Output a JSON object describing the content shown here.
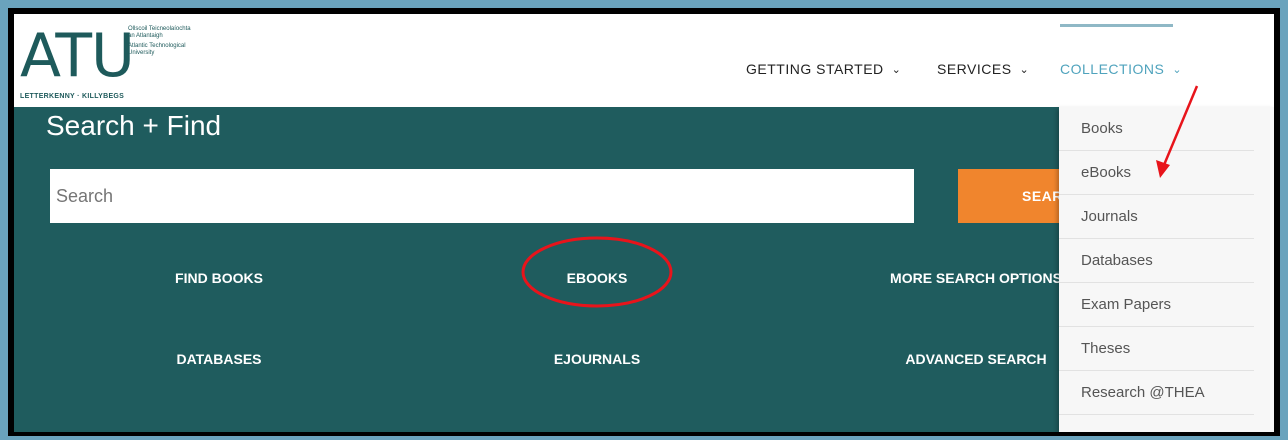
{
  "logo": {
    "letters": "ATU",
    "tagline_ga": "Ollscoil Teicneolaíochta an Atlantaigh",
    "tagline_en": "Atlantic Technological University",
    "campus": "LETTERKENNY · KILLYBEGS"
  },
  "nav": [
    {
      "label": "GETTING STARTED"
    },
    {
      "label": "SERVICES"
    },
    {
      "label": "COLLECTIONS"
    }
  ],
  "search": {
    "title": "Search + Find",
    "placeholder": "Search",
    "button_label": "SEARCH"
  },
  "quick_links": [
    {
      "label": "FIND BOOKS"
    },
    {
      "label": "EBOOKS"
    },
    {
      "label": "MORE SEARCH OPTIONS"
    },
    {
      "label": "DATABASES"
    },
    {
      "label": "EJOURNALS"
    },
    {
      "label": "ADVANCED SEARCH"
    }
  ],
  "collections_menu": [
    {
      "label": "Books"
    },
    {
      "label": "eBooks"
    },
    {
      "label": "Journals"
    },
    {
      "label": "Databases"
    },
    {
      "label": "Exam Papers"
    },
    {
      "label": "Theses"
    },
    {
      "label": "Research @THEA"
    }
  ],
  "colors": {
    "brand_teal": "#1f5c5e",
    "accent_orange": "#f0852d",
    "nav_active": "#4fa3bd",
    "annotation_red": "#e8141b"
  }
}
